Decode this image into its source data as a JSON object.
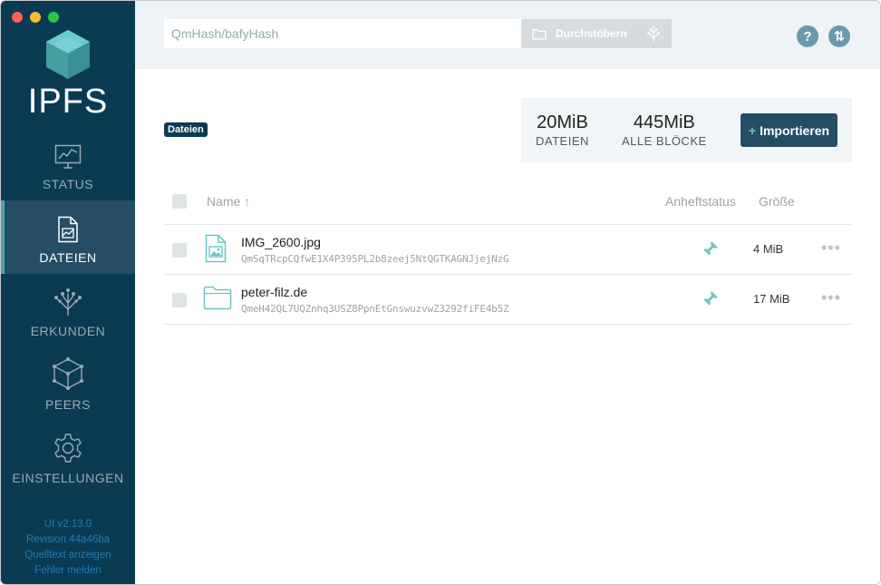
{
  "app": {
    "logo_text": "IPFS"
  },
  "sidebar": {
    "items": [
      {
        "label": "STATUS",
        "icon": "status-chart-icon",
        "active": false
      },
      {
        "label": "DATEIEN",
        "icon": "files-icon",
        "active": true
      },
      {
        "label": "ERKUNDEN",
        "icon": "explore-tree-icon",
        "active": false
      },
      {
        "label": "PEERS",
        "icon": "peers-cube-icon",
        "active": false
      },
      {
        "label": "EINSTELLUNGEN",
        "icon": "gear-icon",
        "active": false
      }
    ],
    "version": "UI v2.13.0",
    "revision": "Revision 44a46ba",
    "source_link": "Quelltext anzeigen",
    "report_link": "Fehler melden"
  },
  "header": {
    "search_placeholder": "QmHash/bafyHash",
    "browse_label": "Durchstöbern",
    "help_icon": "?",
    "transfer_icon": "⇅"
  },
  "main": {
    "breadcrumb": "Dateien",
    "stats": {
      "files_value": "20MiB",
      "files_label": "DATEIEN",
      "blocks_value": "445MiB",
      "blocks_label": "ALLE BLÖCKE"
    },
    "import_plus": "+",
    "import_label": "Importieren",
    "table": {
      "col_name": "Name ↑",
      "col_pin": "Anheftstatus",
      "col_size": "Größe",
      "rows": [
        {
          "name": "IMG_2600.jpg",
          "hash": "QmSqTRcpCQfwE1X4P395PL2b8zeej5NtQGTKAGNJjejNzG",
          "size": "4 MiB",
          "type": "image-file-icon"
        },
        {
          "name": "peter-filz.de",
          "hash": "QmeH42QL7UQZnhq3USZ8PpnEtGnswuzvwZ3292fiFE4b5Z",
          "size": "17 MiB",
          "type": "folder-icon"
        }
      ],
      "more": "•••"
    }
  },
  "colors": {
    "sidebar": "#0b3a53",
    "accent": "#6cc5c4",
    "button": "#244e66"
  }
}
